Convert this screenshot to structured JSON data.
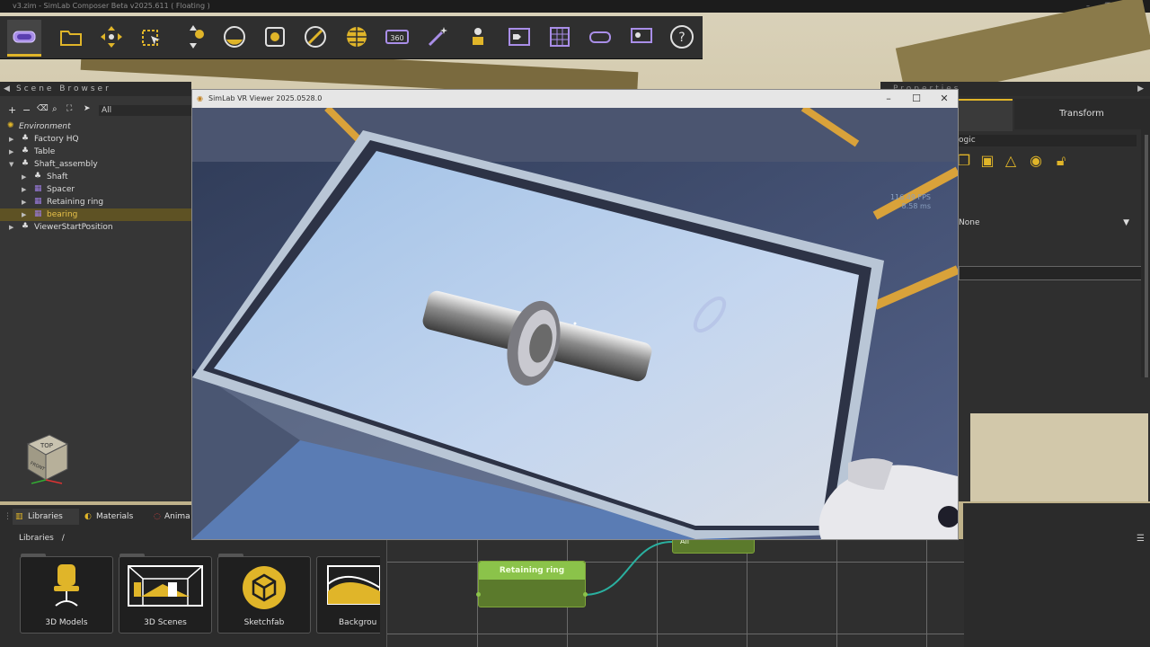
{
  "app": {
    "title": "v3.zim - SimLab Composer Beta v2025.611 ( Floating )",
    "win_min": "–",
    "win_max": "❐",
    "win_close": "✕"
  },
  "toolbar": {
    "items": [
      {
        "name": "vr-headset-icon",
        "active": true
      },
      {
        "name": "open-folder-icon"
      },
      {
        "name": "move-icon"
      },
      {
        "name": "select-box-icon"
      },
      {
        "name": "gizmo-icon"
      },
      {
        "name": "sphere-material-icon"
      },
      {
        "name": "frame-icon"
      },
      {
        "name": "slash-circle-icon"
      },
      {
        "name": "globe-icon"
      },
      {
        "name": "360-icon",
        "text": "360"
      },
      {
        "name": "magic-wand-icon"
      },
      {
        "name": "presenter-icon"
      },
      {
        "name": "sequence-icon"
      },
      {
        "name": "grid-icon"
      },
      {
        "name": "vr-glasses-icon"
      },
      {
        "name": "user-screen-icon"
      },
      {
        "name": "help-icon",
        "text": "?"
      }
    ]
  },
  "scene_browser": {
    "title": "Scene Browser",
    "filter": "All",
    "tree": [
      {
        "label": "Environment",
        "level": 0,
        "icon": "sun",
        "italic": true
      },
      {
        "label": "Factory HQ",
        "level": 0,
        "icon": "node",
        "arrow": "▶"
      },
      {
        "label": "Table",
        "level": 0,
        "icon": "node",
        "arrow": "▶"
      },
      {
        "label": "Shaft_assembly",
        "level": 0,
        "icon": "node",
        "arrow": "▼"
      },
      {
        "label": "Shaft",
        "level": 1,
        "icon": "node",
        "arrow": "▶"
      },
      {
        "label": "Spacer",
        "level": 1,
        "icon": "mesh",
        "arrow": "▶"
      },
      {
        "label": "Retaining ring",
        "level": 1,
        "icon": "mesh",
        "arrow": "▶"
      },
      {
        "label": "bearing",
        "level": 1,
        "icon": "mesh",
        "arrow": "▶",
        "selected": true
      },
      {
        "label": "ViewerStartPosition",
        "level": 0,
        "icon": "node",
        "arrow": "▶"
      }
    ]
  },
  "gizmo": {
    "top": "TOP",
    "front": "FRONT"
  },
  "libraries": {
    "tabs": [
      "Libraries",
      "Materials",
      "Anima"
    ],
    "breadcrumb": "Libraries",
    "breadcrumb_sep": "/",
    "cards": [
      "3D Models",
      "3D Scenes",
      "Sketchfab",
      "Backgrou"
    ]
  },
  "graph": {
    "node_label": "Retaining ring",
    "node2_label": "All"
  },
  "properties": {
    "title": "Properties",
    "tab_transform": "Transform",
    "logic_label": "ogic",
    "dropdown_value": "None"
  },
  "vr_viewer": {
    "title": "SimLab VR Viewer 2025.0528.0",
    "fps": "116.49 FPS",
    "ms": "8.58 ms",
    "btn_min": "–",
    "btn_max": "☐",
    "btn_close": "✕"
  },
  "colors": {
    "accent": "#e0b529",
    "node_green": "#8bc34a",
    "selection": "#5e5224"
  }
}
